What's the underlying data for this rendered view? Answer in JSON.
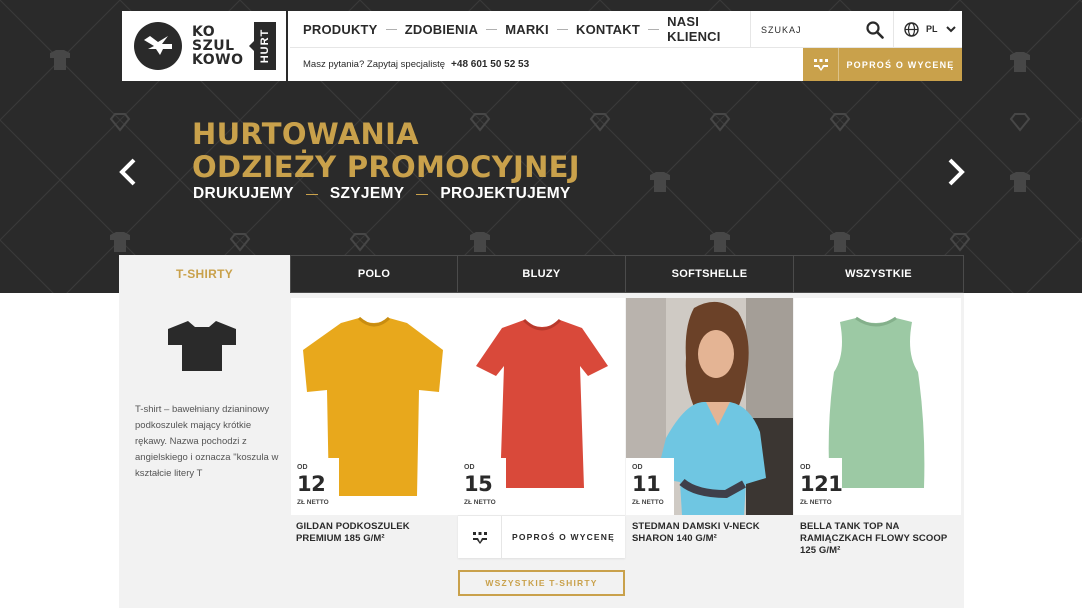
{
  "header": {
    "logo_lines": [
      "KO",
      "SZUL",
      "KOWO"
    ],
    "logo_tag": "HURT",
    "nav": [
      "PRODUKTY",
      "ZDOBIENIA",
      "MARKI",
      "KONTAKT",
      "NASI KLIENCI"
    ],
    "search_placeholder": "SZUKAJ",
    "language": "PL",
    "contact_question": "Masz pytania? Zapytaj specjalistę",
    "phone": "+48 601 50 52 53",
    "quote_button": "POPROŚ O WYCENĘ"
  },
  "hero": {
    "title_line1": "HURTOWANIA",
    "title_line2": "ODZIEŻY PROMOCYJNEJ",
    "sub": [
      "DRUKUJEMY",
      "SZYJEMY",
      "PROJEKTUJEMY"
    ]
  },
  "tabs": [
    "T-SHIRTY",
    "POLO",
    "BLUZY",
    "SOFTSHELLE",
    "WSZYSTKIE"
  ],
  "category": {
    "icon": "tshirt-icon",
    "description": "T-shirt – bawełniany dzianinowy podkoszulek mający krótkie rękawy. Nazwa pochodzi z angielskiego i oznacza \"koszula w kształcie litery T"
  },
  "products": [
    {
      "od": "OD",
      "price": "12",
      "unit": "ZŁ NETTO",
      "title": "GILDAN PODKOSZULEK PREMIUM 185 G/M²",
      "color": "#e8a81c"
    },
    {
      "od": "OD",
      "price": "15",
      "unit": "ZŁ NETTO",
      "title": "",
      "color": "#d9493a"
    },
    {
      "od": "OD",
      "price": "11",
      "unit": "ZŁ NETTO",
      "title": "STEDMAN DAMSKI V-NECK SHARON 140 G/M²",
      "color": "#6fc6e2"
    },
    {
      "od": "OD",
      "price": "121",
      "unit": "ZŁ NETTO",
      "title": "BELLA TANK TOP NA RAMIĄCZKACH FLOWY SCOOP 125 G/M²",
      "color": "#9cc9a4"
    }
  ],
  "card_quote": "POPROŚ O WYCENĘ",
  "all_button": "WSZYSTKIE T-SHIRTY",
  "colors": {
    "accent": "#c9a14b",
    "dark": "#2a2a2a",
    "panel": "#f2f2f2"
  }
}
